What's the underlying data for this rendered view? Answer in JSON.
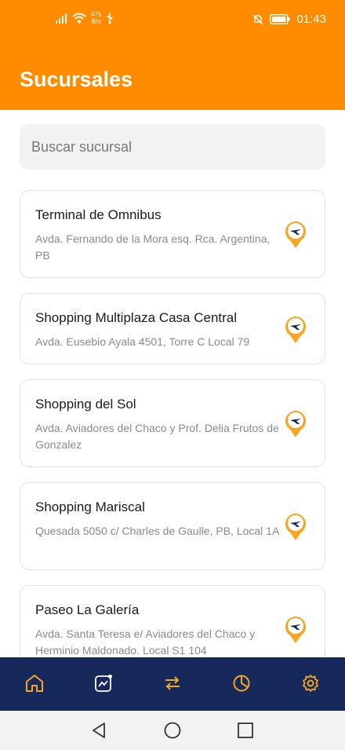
{
  "status_bar": {
    "net_speed_value": "475",
    "net_speed_unit": "B/s",
    "time": "01:43"
  },
  "header": {
    "title": "Sucursales"
  },
  "search": {
    "placeholder": "Buscar sucursal",
    "value": ""
  },
  "branches": [
    {
      "name": "Terminal de Omnibus",
      "address": "Avda. Fernando de la Mora esq. Rca. Argentina, PB"
    },
    {
      "name": "Shopping Multiplaza Casa Central",
      "address": "Avda. Eusebio Ayala 4501, Torre C Local 79"
    },
    {
      "name": "Shopping del Sol",
      "address": "Avda. Aviadores del Chaco y Prof. Delia Frutos de Gonzalez"
    },
    {
      "name": "Shopping Mariscal",
      "address": "Quesada 5050 c/ Charles de Gaulle, PB, Local 1A"
    },
    {
      "name": "Paseo La Galería",
      "address": "Avda. Santa Teresa e/ Aviadores del Chaco y Herminio Maldonado. Local S1 104"
    }
  ],
  "bottom_nav": [
    {
      "icon": "home-icon"
    },
    {
      "icon": "chart-trend-icon"
    },
    {
      "icon": "transfer-arrows-icon"
    },
    {
      "icon": "pie-chart-icon"
    },
    {
      "icon": "settings-gear-icon"
    }
  ],
  "colors": {
    "primary": "#FF8C00",
    "nav_background": "#16295A",
    "nav_icon": "#F5A623"
  }
}
